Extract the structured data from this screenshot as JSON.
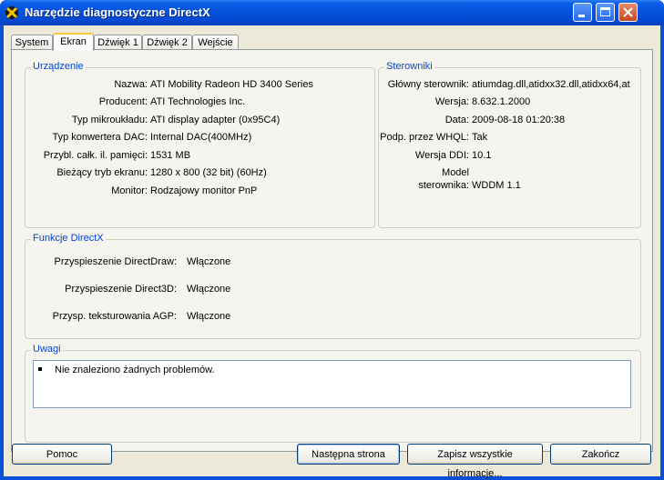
{
  "window": {
    "title": "Narzędzie diagnostyczne DirectX"
  },
  "tabs": [
    {
      "label": "System"
    },
    {
      "label": "Ekran"
    },
    {
      "label": "Dźwięk 1"
    },
    {
      "label": "Dźwięk 2"
    },
    {
      "label": "Wejście"
    }
  ],
  "device": {
    "title": "Urządzenie",
    "rows": [
      {
        "label": "Nazwa:",
        "value": "ATI Mobility Radeon HD 3400 Series"
      },
      {
        "label": "Producent:",
        "value": "ATI Technologies Inc."
      },
      {
        "label": "Typ mikroukładu:",
        "value": "ATI display adapter (0x95C4)"
      },
      {
        "label": "Typ konwertera DAC:",
        "value": "Internal DAC(400MHz)"
      },
      {
        "label": "Przybl. całk. il. pamięci:",
        "value": "1531 MB"
      },
      {
        "label": "Bieżący tryb ekranu:",
        "value": "1280 x 800 (32 bit) (60Hz)"
      },
      {
        "label": "Monitor:",
        "value": "Rodzajowy monitor PnP"
      }
    ]
  },
  "drivers": {
    "title": "Sterowniki",
    "rows": [
      {
        "label": "Główny sterownik:",
        "value": "atiumdag.dll,atidxx32.dll,atidxx64,at"
      },
      {
        "label": "Wersja:",
        "value": "8.632.1.2000"
      },
      {
        "label": "Data:",
        "value": "2009-08-18 01:20:38"
      },
      {
        "label": "Podp. przez WHQL:",
        "value": "Tak"
      },
      {
        "label": "Wersja DDI:",
        "value": "10.1"
      }
    ],
    "model_label_line1": "Model",
    "model_label_line2": "sterownika:",
    "model_value": "WDDM 1.1"
  },
  "directx": {
    "title": "Funkcje DirectX",
    "rows": [
      {
        "label": "Przyspieszenie DirectDraw:",
        "value": "Włączone"
      },
      {
        "label": "Przyspieszenie Direct3D:",
        "value": "Włączone"
      },
      {
        "label": "Przysp. teksturowania AGP:",
        "value": "Włączone"
      }
    ]
  },
  "notes": {
    "title": "Uwagi",
    "items": [
      "Nie znaleziono żadnych problemów."
    ]
  },
  "buttons": {
    "help": "Pomoc",
    "next": "Następna strona",
    "save_all": "Zapisz wszystkie informacje...",
    "exit": "Zakończ"
  },
  "colors": {
    "title_bar": "#0552dc",
    "group_title": "#0046d5",
    "dialog_bg": "#ece9d8"
  }
}
